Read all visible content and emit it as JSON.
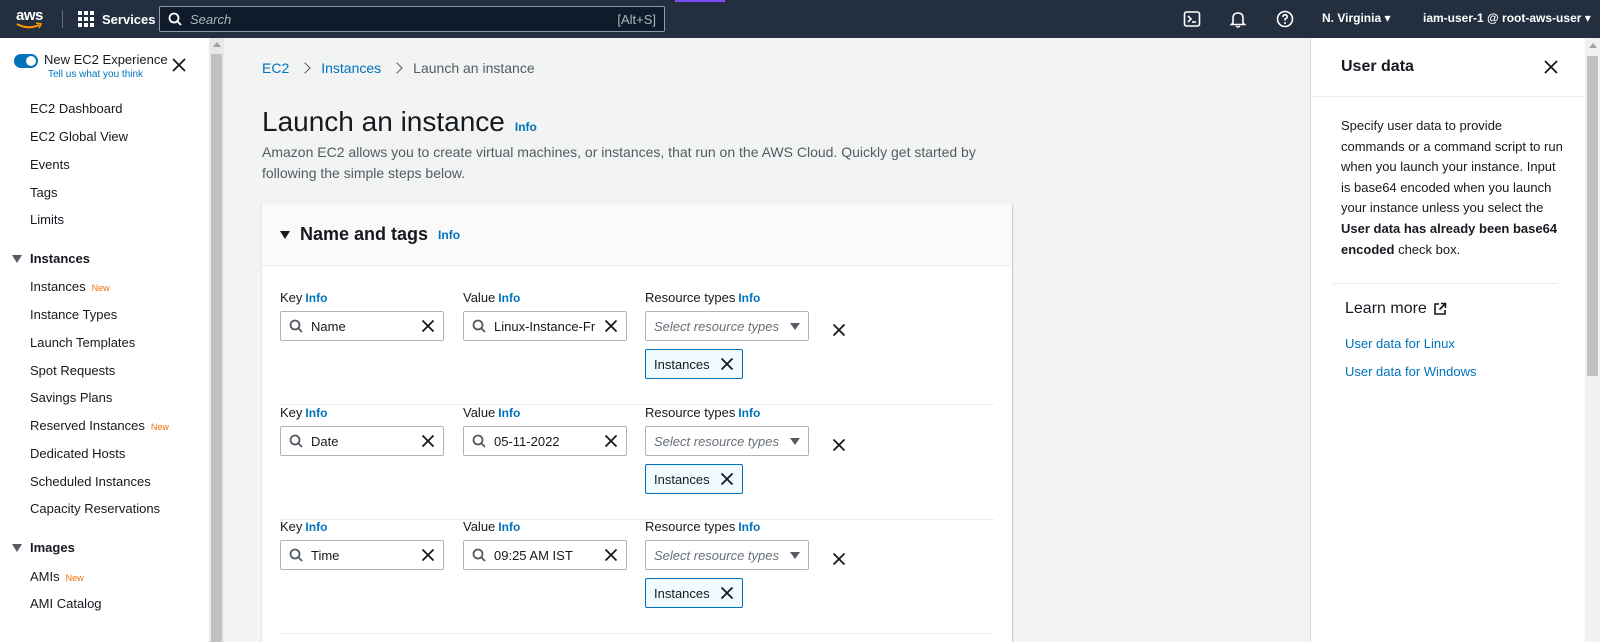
{
  "topnav": {
    "logo": "aws",
    "services_label": "Services",
    "search_placeholder": "Search",
    "search_shortcut": "[Alt+S]",
    "region": "N. Virginia ▾",
    "user": "iam-user-1 @ root-aws-user ▾",
    "icons": [
      "cloudshell-icon",
      "bell-icon",
      "help-icon"
    ]
  },
  "sidebar": {
    "toggle_label": "New EC2 Experience",
    "toggle_sublabel": "Tell us what you think",
    "new_badge": "New",
    "items_top": [
      "EC2 Dashboard",
      "EC2 Global View",
      "Events",
      "Tags",
      "Limits"
    ],
    "instances_section": "Instances",
    "instances_items": [
      {
        "label": "Instances",
        "new": true
      },
      {
        "label": "Instance Types",
        "new": false
      },
      {
        "label": "Launch Templates",
        "new": false
      },
      {
        "label": "Spot Requests",
        "new": false
      },
      {
        "label": "Savings Plans",
        "new": false
      },
      {
        "label": "Reserved Instances",
        "new": true
      },
      {
        "label": "Dedicated Hosts",
        "new": false
      },
      {
        "label": "Scheduled Instances",
        "new": false
      },
      {
        "label": "Capacity Reservations",
        "new": false
      }
    ],
    "images_section": "Images",
    "images_items": [
      {
        "label": "AMIs",
        "new": true
      },
      {
        "label": "AMI Catalog",
        "new": false
      }
    ]
  },
  "main": {
    "breadcrumb": [
      "EC2",
      "Instances",
      "Launch an instance"
    ],
    "title": "Launch an instance",
    "info": "Info",
    "description": "Amazon EC2 allows you to create virtual machines, or instances, that run on the AWS Cloud. Quickly get started by following the simple steps below.",
    "section_title": "Name and tags",
    "labels": {
      "key": "Key",
      "value": "Value",
      "resource_types": "Resource types"
    },
    "select_placeholder": "Select resource types",
    "tags": [
      {
        "key": "Name",
        "value": "Linux-Instance-Fr",
        "token": "Instances"
      },
      {
        "key": "Date",
        "value": "05-11-2022",
        "token": "Instances"
      },
      {
        "key": "Time",
        "value": "09:25 AM IST",
        "token": "Instances"
      }
    ]
  },
  "panel": {
    "title": "User data",
    "body_parts": [
      "Specify user data to provide commands or a command script to run when you launch your instance. Input is base64 encoded when you launch your instance unless you select the ",
      "User data has already been base64 encoded",
      " check box."
    ],
    "learn_more": "Learn more",
    "links": [
      "User data for Linux",
      "User data for Windows"
    ]
  },
  "colors": {
    "nav_bg": "#232f3e",
    "link": "#0073bb",
    "new_badge": "#ec7211"
  }
}
